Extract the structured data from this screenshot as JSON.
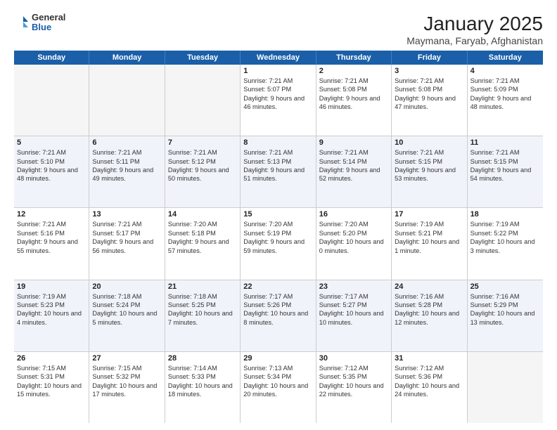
{
  "header": {
    "logo_general": "General",
    "logo_blue": "Blue",
    "title": "January 2025",
    "subtitle": "Maymana, Faryab, Afghanistan"
  },
  "weekdays": [
    "Sunday",
    "Monday",
    "Tuesday",
    "Wednesday",
    "Thursday",
    "Friday",
    "Saturday"
  ],
  "weeks": [
    [
      {
        "day": "",
        "text": "",
        "empty": true
      },
      {
        "day": "",
        "text": "",
        "empty": true
      },
      {
        "day": "",
        "text": "",
        "empty": true
      },
      {
        "day": "1",
        "text": "Sunrise: 7:21 AM\nSunset: 5:07 PM\nDaylight: 9 hours and 46 minutes.",
        "empty": false
      },
      {
        "day": "2",
        "text": "Sunrise: 7:21 AM\nSunset: 5:08 PM\nDaylight: 9 hours and 46 minutes.",
        "empty": false
      },
      {
        "day": "3",
        "text": "Sunrise: 7:21 AM\nSunset: 5:08 PM\nDaylight: 9 hours and 47 minutes.",
        "empty": false
      },
      {
        "day": "4",
        "text": "Sunrise: 7:21 AM\nSunset: 5:09 PM\nDaylight: 9 hours and 48 minutes.",
        "empty": false
      }
    ],
    [
      {
        "day": "5",
        "text": "Sunrise: 7:21 AM\nSunset: 5:10 PM\nDaylight: 9 hours and 48 minutes.",
        "empty": false
      },
      {
        "day": "6",
        "text": "Sunrise: 7:21 AM\nSunset: 5:11 PM\nDaylight: 9 hours and 49 minutes.",
        "empty": false
      },
      {
        "day": "7",
        "text": "Sunrise: 7:21 AM\nSunset: 5:12 PM\nDaylight: 9 hours and 50 minutes.",
        "empty": false
      },
      {
        "day": "8",
        "text": "Sunrise: 7:21 AM\nSunset: 5:13 PM\nDaylight: 9 hours and 51 minutes.",
        "empty": false
      },
      {
        "day": "9",
        "text": "Sunrise: 7:21 AM\nSunset: 5:14 PM\nDaylight: 9 hours and 52 minutes.",
        "empty": false
      },
      {
        "day": "10",
        "text": "Sunrise: 7:21 AM\nSunset: 5:15 PM\nDaylight: 9 hours and 53 minutes.",
        "empty": false
      },
      {
        "day": "11",
        "text": "Sunrise: 7:21 AM\nSunset: 5:15 PM\nDaylight: 9 hours and 54 minutes.",
        "empty": false
      }
    ],
    [
      {
        "day": "12",
        "text": "Sunrise: 7:21 AM\nSunset: 5:16 PM\nDaylight: 9 hours and 55 minutes.",
        "empty": false
      },
      {
        "day": "13",
        "text": "Sunrise: 7:21 AM\nSunset: 5:17 PM\nDaylight: 9 hours and 56 minutes.",
        "empty": false
      },
      {
        "day": "14",
        "text": "Sunrise: 7:20 AM\nSunset: 5:18 PM\nDaylight: 9 hours and 57 minutes.",
        "empty": false
      },
      {
        "day": "15",
        "text": "Sunrise: 7:20 AM\nSunset: 5:19 PM\nDaylight: 9 hours and 59 minutes.",
        "empty": false
      },
      {
        "day": "16",
        "text": "Sunrise: 7:20 AM\nSunset: 5:20 PM\nDaylight: 10 hours and 0 minutes.",
        "empty": false
      },
      {
        "day": "17",
        "text": "Sunrise: 7:19 AM\nSunset: 5:21 PM\nDaylight: 10 hours and 1 minute.",
        "empty": false
      },
      {
        "day": "18",
        "text": "Sunrise: 7:19 AM\nSunset: 5:22 PM\nDaylight: 10 hours and 3 minutes.",
        "empty": false
      }
    ],
    [
      {
        "day": "19",
        "text": "Sunrise: 7:19 AM\nSunset: 5:23 PM\nDaylight: 10 hours and 4 minutes.",
        "empty": false
      },
      {
        "day": "20",
        "text": "Sunrise: 7:18 AM\nSunset: 5:24 PM\nDaylight: 10 hours and 5 minutes.",
        "empty": false
      },
      {
        "day": "21",
        "text": "Sunrise: 7:18 AM\nSunset: 5:25 PM\nDaylight: 10 hours and 7 minutes.",
        "empty": false
      },
      {
        "day": "22",
        "text": "Sunrise: 7:17 AM\nSunset: 5:26 PM\nDaylight: 10 hours and 8 minutes.",
        "empty": false
      },
      {
        "day": "23",
        "text": "Sunrise: 7:17 AM\nSunset: 5:27 PM\nDaylight: 10 hours and 10 minutes.",
        "empty": false
      },
      {
        "day": "24",
        "text": "Sunrise: 7:16 AM\nSunset: 5:28 PM\nDaylight: 10 hours and 12 minutes.",
        "empty": false
      },
      {
        "day": "25",
        "text": "Sunrise: 7:16 AM\nSunset: 5:29 PM\nDaylight: 10 hours and 13 minutes.",
        "empty": false
      }
    ],
    [
      {
        "day": "26",
        "text": "Sunrise: 7:15 AM\nSunset: 5:31 PM\nDaylight: 10 hours and 15 minutes.",
        "empty": false
      },
      {
        "day": "27",
        "text": "Sunrise: 7:15 AM\nSunset: 5:32 PM\nDaylight: 10 hours and 17 minutes.",
        "empty": false
      },
      {
        "day": "28",
        "text": "Sunrise: 7:14 AM\nSunset: 5:33 PM\nDaylight: 10 hours and 18 minutes.",
        "empty": false
      },
      {
        "day": "29",
        "text": "Sunrise: 7:13 AM\nSunset: 5:34 PM\nDaylight: 10 hours and 20 minutes.",
        "empty": false
      },
      {
        "day": "30",
        "text": "Sunrise: 7:12 AM\nSunset: 5:35 PM\nDaylight: 10 hours and 22 minutes.",
        "empty": false
      },
      {
        "day": "31",
        "text": "Sunrise: 7:12 AM\nSunset: 5:36 PM\nDaylight: 10 hours and 24 minutes.",
        "empty": false
      },
      {
        "day": "",
        "text": "",
        "empty": true
      }
    ]
  ]
}
